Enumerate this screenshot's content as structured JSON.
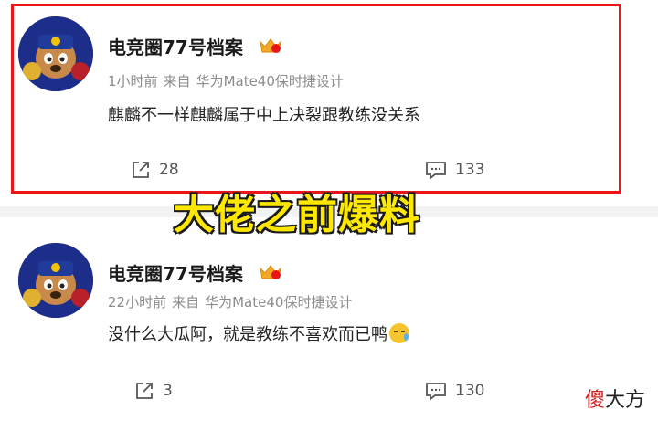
{
  "posts": [
    {
      "username": "电竞圈77号档案",
      "time": "1小时前",
      "source_prefix": "来自",
      "source": "华为Mate40保时捷设计",
      "content": "麒麟不一样麒麟属于中上决裂跟教练没关系",
      "shares": "28",
      "comments": "133"
    },
    {
      "username": "电竞圈77号档案",
      "time": "22小时前",
      "source_prefix": "来自",
      "source": "华为Mate40保时捷设计",
      "content": "没什么大瓜阿，就是教练不喜欢而已鸭",
      "shares": "3",
      "comments": "130"
    }
  ],
  "banner": "大佬之前爆料",
  "watermark": {
    "part1": "傻",
    "part2": "大方"
  },
  "colors": {
    "highlight": "#e8151b",
    "banner_fill": "#ffe800",
    "watermark_red": "#d21f1f"
  }
}
